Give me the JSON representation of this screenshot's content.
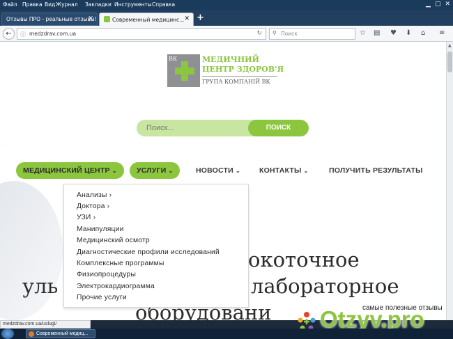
{
  "browser": {
    "menu": [
      "Файл",
      "Правка",
      "Вид",
      "Журнал",
      "Закладки",
      "Инструменты",
      "Справка"
    ],
    "tabs": [
      {
        "title": "Отзывы ПРО - реальные отзывы!",
        "active": false
      },
      {
        "title": "Современный медицинс...",
        "active": true
      }
    ],
    "url": "medzdrav.com.ua",
    "search_placeholder": "Поиск",
    "status_url": "medzdrav.com.ua/uslugi/"
  },
  "site": {
    "logo": {
      "badge": "ВК",
      "line1": "МЕДИЧНИЙ",
      "line2": "ЦЕНТР ЗДОРОВ'Я",
      "line3": "ГРУПА КОМПАНІЙ ВК"
    },
    "search": {
      "placeholder": "Поиск...",
      "button": "ПОИСК"
    },
    "nav": [
      {
        "label": "МЕДИЦИНСКИЙ ЦЕНТР",
        "chevron": "⌄"
      },
      {
        "label": "УСЛУГИ",
        "chevron": "⌄"
      },
      {
        "label": "НОВОСТИ",
        "chevron": "⌄"
      },
      {
        "label": "КОНТАКТЫ",
        "chevron": "⌄"
      },
      {
        "label": "ПОЛУЧИТЬ РЕЗУЛЬТАТЫ"
      }
    ],
    "dropdown": [
      "Анализы ›",
      "Доктора ›",
      "УЗИ ›",
      "Манипуляции",
      "Медицинский осмотр",
      "Диагностические профили исследований",
      "Комплексные программы",
      "Физиопроцедуры",
      "Электрокардиограмма",
      "Прочие услуги"
    ],
    "hero": {
      "line1": "окоточное",
      "line2a": "уль",
      "line2b": "лабораторное",
      "line3": "оборудовани"
    }
  },
  "watermark": {
    "tagline": "самые полезные отзывы",
    "brand": "Otzyv.pro"
  },
  "taskbar": {
    "item": "Современный медиц..."
  },
  "colors": {
    "accent": "#8cc63f",
    "accent_light": "#c8e6a2",
    "chrome_dark": "#1b3b5c"
  }
}
